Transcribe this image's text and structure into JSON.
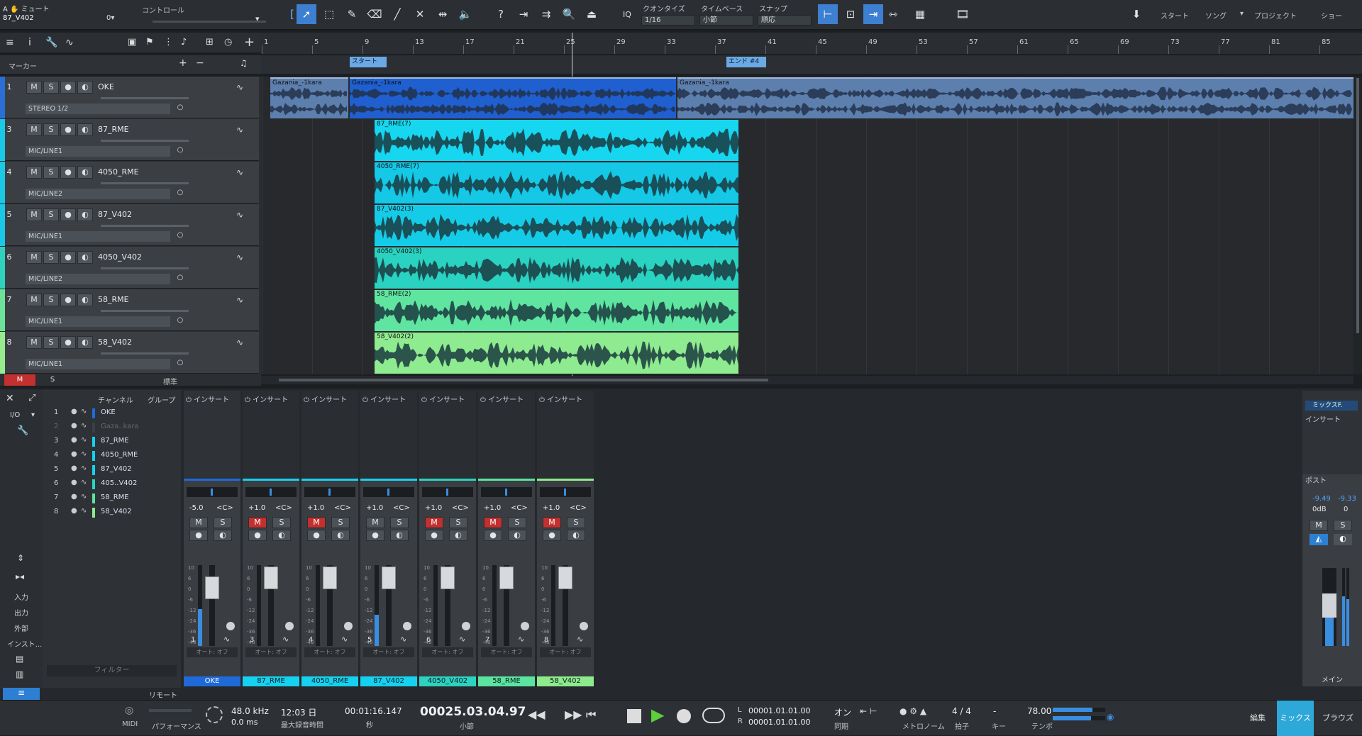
{
  "header": {
    "mute_label": "ミュート",
    "control_label": "コントロール",
    "selected_track": "87_V402",
    "level": "0▾"
  },
  "toolbar": {
    "quantize_label": "クオンタイズ",
    "quantize_value": "1/16",
    "timebase_label": "タイムベース",
    "timebase_value": "小節",
    "snap_label": "スナップ",
    "snap_value": "順応",
    "iq": "IQ"
  },
  "nav": {
    "start": "スタート",
    "song": "ソング",
    "project": "プロジェクト",
    "show": "ショー"
  },
  "ruler": {
    "ticks": [
      "1",
      "5",
      "9",
      "13",
      "17",
      "21",
      "25",
      "29",
      "33",
      "37",
      "41",
      "45",
      "49",
      "53",
      "57",
      "61",
      "65",
      "69",
      "73",
      "77",
      "81",
      "85"
    ],
    "marker_label": "マーカー",
    "start_marker": "スタート",
    "end_marker": "エンド #4"
  },
  "tracks": [
    {
      "num": "1",
      "name": "OKE",
      "input": "STEREO 1/2",
      "color": "#2a6fd6",
      "muted": false
    },
    {
      "num": "3",
      "name": "87_RME",
      "input": "MIC/LINE1",
      "color": "#19c9e6",
      "muted": true
    },
    {
      "num": "4",
      "name": "4050_RME",
      "input": "MIC/LINE2",
      "color": "#19c9e6",
      "muted": true
    },
    {
      "num": "5",
      "name": "87_V402",
      "input": "MIC/LINE1",
      "color": "#19c9e6",
      "muted": false
    },
    {
      "num": "6",
      "name": "4050_V402",
      "input": "MIC/LINE2",
      "color": "#2fd2bf",
      "muted": true
    },
    {
      "num": "7",
      "name": "58_RME",
      "input": "MIC/LINE1",
      "color": "#6de39a",
      "muted": true
    },
    {
      "num": "8",
      "name": "58_V402",
      "input": "MIC/LINE1",
      "color": "#95ec8e",
      "muted": true
    }
  ],
  "clips": [
    {
      "label": "Gazania_-1kara",
      "color": "#5c7fae"
    },
    {
      "label": "Gazania_-1kara",
      "color": "#1f5fd0"
    },
    {
      "label": "Gazania_-1kara",
      "color": "#5c7fae"
    },
    {
      "label": "87_RME(7)",
      "color": "#16d6f0"
    },
    {
      "label": "4050_RME(7)",
      "color": "#14c8e6"
    },
    {
      "label": "87_V402(3)",
      "color": "#15cce8"
    },
    {
      "label": "4050_V402(3)",
      "color": "#29d2c1"
    },
    {
      "label": "58_RME(2)",
      "color": "#5fe5a0"
    },
    {
      "label": "58_V402(2)",
      "color": "#8feb8f"
    }
  ],
  "trackfoot": {
    "m": "M",
    "s": "S",
    "std": "標準"
  },
  "channel_list": {
    "header_channel": "チャンネル",
    "header_group": "グループ",
    "io": "I/O",
    "filter": "フィルター",
    "remote": "リモート",
    "items": [
      {
        "n": "1",
        "name": "OKE"
      },
      {
        "n": "2",
        "name": "Gaza..kara"
      },
      {
        "n": "3",
        "name": "87_RME"
      },
      {
        "n": "4",
        "name": "4050_RME"
      },
      {
        "n": "5",
        "name": "87_V402"
      },
      {
        "n": "6",
        "name": "405..V402"
      },
      {
        "n": "7",
        "name": "58_RME"
      },
      {
        "n": "8",
        "name": "58_V402"
      }
    ]
  },
  "left_panel": {
    "input": "入力",
    "output": "出力",
    "external": "外部",
    "instrument": "インスト..."
  },
  "strips": [
    {
      "num": "1",
      "name": "OKE",
      "vol": "-5.0",
      "pan": "<C>",
      "color": "#1f6ad8",
      "muted": false
    },
    {
      "num": "3",
      "name": "87_RME",
      "vol": "+1.0",
      "pan": "<C>",
      "color": "#15d2f0",
      "muted": true
    },
    {
      "num": "4",
      "name": "4050_RME",
      "vol": "+1.0",
      "pan": "<C>",
      "color": "#15d2f0",
      "muted": true
    },
    {
      "num": "5",
      "name": "87_V402",
      "vol": "+1.0",
      "pan": "<C>",
      "color": "#15d2f0",
      "muted": false
    },
    {
      "num": "6",
      "name": "4050_V402",
      "vol": "+1.0",
      "pan": "<C>",
      "color": "#2bd3c0",
      "muted": true
    },
    {
      "num": "7",
      "name": "58_RME",
      "vol": "+1.0",
      "pan": "<C>",
      "color": "#5ae4a0",
      "muted": true
    },
    {
      "num": "8",
      "name": "58_V402",
      "vol": "+1.0",
      "pan": "<C>",
      "color": "#8deb8c",
      "muted": true
    }
  ],
  "strip_common": {
    "insert": "インサート",
    "auto": "オート: オフ",
    "m": "M",
    "s": "S",
    "scale": [
      "10",
      "6",
      "0",
      "-6",
      "-12",
      "-24",
      "-36",
      "-48"
    ]
  },
  "main_strip": {
    "mix_label": "ミックスF.",
    "insert": "インサート",
    "post": "ポスト",
    "left_peak": "-9.49",
    "right_peak": "-9.33",
    "vol": "0dB",
    "pan": "0",
    "name": "メイン"
  },
  "transport": {
    "midi": "MIDI",
    "perf": "パフォーマンス",
    "sample_rate": "48.0 kHz",
    "latency": "0.0 ms",
    "rec_time": "12:03 日",
    "rec_time_label": "最大録音時間",
    "time_sec": "00:01:16.147",
    "time_sec_label": "秒",
    "bars": "00025.03.04.97",
    "bars_label": "小節",
    "loop_l": "00001.01.01.00",
    "loop_r": "00001.01.01.00",
    "sync": "オン",
    "sync_label": "同期",
    "metronome_label": "メトロノーム",
    "signature": "4 / 4",
    "signature_label": "拍子",
    "key": "-",
    "key_label": "キー",
    "tempo": "78.00",
    "tempo_label": "テンポ",
    "edit": "編集",
    "mix": "ミックス",
    "browse": "ブラウズ",
    "L": "L",
    "R": "R"
  }
}
